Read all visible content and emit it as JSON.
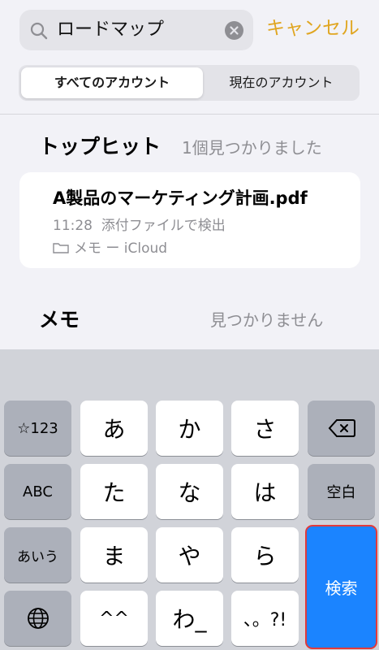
{
  "search": {
    "query": "ロードマップ",
    "cancel_label": "キャンセル"
  },
  "segments": {
    "all_accounts": "すべてのアカウント",
    "current_account": "現在のアカウント"
  },
  "top_hits": {
    "title": "トップヒット",
    "count_text": "1個見つかりました",
    "result": {
      "title": "A製品のマーケティング計画.pdf",
      "time": "11:28",
      "detail": "添付ファイルで検出",
      "location": "メモ ー iCloud"
    }
  },
  "notes": {
    "title": "メモ",
    "status": "見つかりません"
  },
  "keyboard": {
    "row1": [
      "☆123",
      "あ",
      "か",
      "さ"
    ],
    "row2": [
      "ABC",
      "た",
      "な",
      "は",
      "空白"
    ],
    "row3": [
      "あいう",
      "ま",
      "や",
      "ら",
      "検索"
    ],
    "row4": [
      "^^",
      "わ_",
      "、。?!"
    ],
    "delete_icon": "backspace-icon",
    "globe_icon": "globe-icon",
    "accent_color": "#1b84ff",
    "highlight_color": "#e23a3a"
  }
}
